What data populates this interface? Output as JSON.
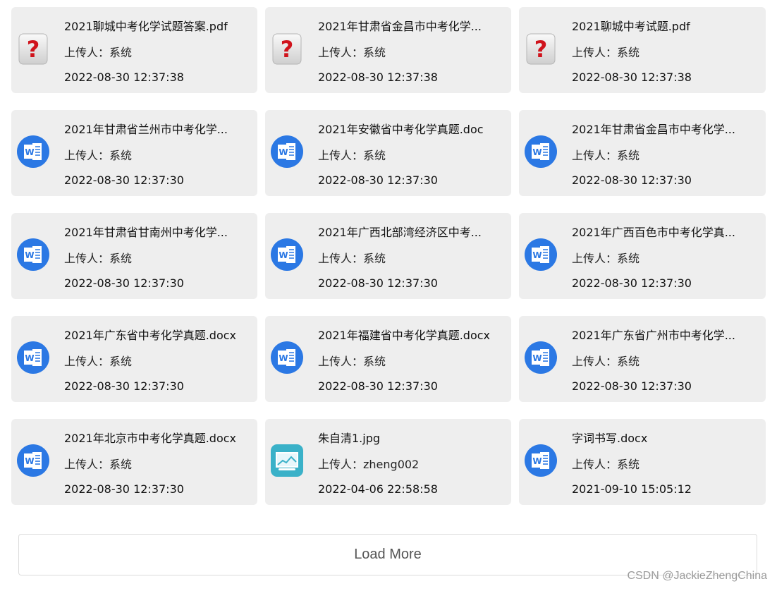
{
  "uploader_label": "上传人：",
  "files": [
    {
      "name": "2021聊城中考化学试题答案.pdf",
      "uploader": "系统",
      "date": "2022-08-30 12:37:38",
      "icon": "unknown-file-icon"
    },
    {
      "name": "2021年甘肃省金昌市中考化学...",
      "uploader": "系统",
      "date": "2022-08-30 12:37:38",
      "icon": "unknown-file-icon"
    },
    {
      "name": "2021聊城中考试题.pdf",
      "uploader": "系统",
      "date": "2022-08-30 12:37:38",
      "icon": "unknown-file-icon"
    },
    {
      "name": "2021年甘肃省兰州市中考化学...",
      "uploader": "系统",
      "date": "2022-08-30 12:37:30",
      "icon": "word-icon"
    },
    {
      "name": "2021年安徽省中考化学真题.doc",
      "uploader": "系统",
      "date": "2022-08-30 12:37:30",
      "icon": "word-icon"
    },
    {
      "name": "2021年甘肃省金昌市中考化学...",
      "uploader": "系统",
      "date": "2022-08-30 12:37:30",
      "icon": "word-icon"
    },
    {
      "name": "2021年甘肃省甘南州中考化学...",
      "uploader": "系统",
      "date": "2022-08-30 12:37:30",
      "icon": "word-icon"
    },
    {
      "name": "2021年广西北部湾经济区中考...",
      "uploader": "系统",
      "date": "2022-08-30 12:37:30",
      "icon": "word-icon"
    },
    {
      "name": "2021年广西百色市中考化学真...",
      "uploader": "系统",
      "date": "2022-08-30 12:37:30",
      "icon": "word-icon"
    },
    {
      "name": "2021年广东省中考化学真题.docx",
      "uploader": "系统",
      "date": "2022-08-30 12:37:30",
      "icon": "word-icon"
    },
    {
      "name": "2021年福建省中考化学真题.docx",
      "uploader": "系统",
      "date": "2022-08-30 12:37:30",
      "icon": "word-icon"
    },
    {
      "name": "2021年广东省广州市中考化学...",
      "uploader": "系统",
      "date": "2022-08-30 12:37:30",
      "icon": "word-icon"
    },
    {
      "name": "2021年北京市中考化学真题.docx",
      "uploader": "系统",
      "date": "2022-08-30 12:37:30",
      "icon": "word-icon"
    },
    {
      "name": "朱自清1.jpg",
      "uploader": "zheng002",
      "date": "2022-04-06 22:58:58",
      "icon": "image-icon"
    },
    {
      "name": "字词书写.docx",
      "uploader": "系统",
      "date": "2021-09-10 15:05:12",
      "icon": "word-icon"
    }
  ],
  "load_more_label": "Load More",
  "watermark": "CSDN @JackieZhengChina",
  "colors": {
    "card_bg": "#eeeeee",
    "word_blue": "#2b78e4",
    "image_teal": "#3ab1c8",
    "unknown_red": "#d0131c"
  }
}
